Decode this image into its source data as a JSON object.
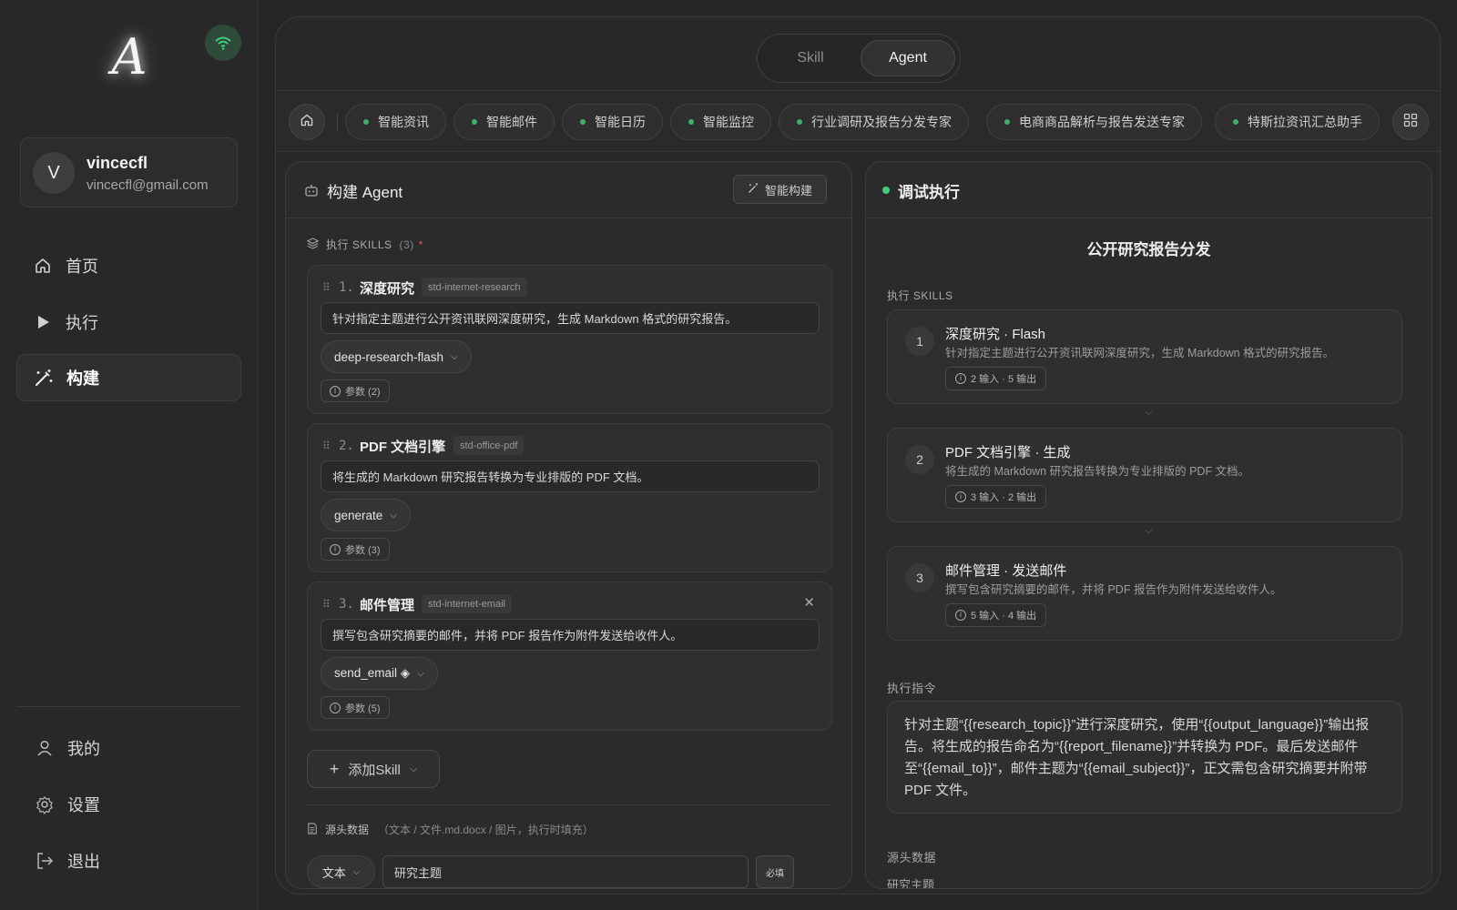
{
  "sidebar": {
    "logo": "A",
    "user": {
      "initial": "V",
      "name": "vincecfl",
      "email": "vincecfl@gmail.com"
    },
    "nav": [
      {
        "label": "首页",
        "icon": "home-icon"
      },
      {
        "label": "执行",
        "icon": "play-icon"
      },
      {
        "label": "构建",
        "icon": "magic-wand-icon",
        "active": true
      }
    ],
    "bottom_nav": [
      {
        "label": "我的",
        "icon": "user-icon"
      },
      {
        "label": "设置",
        "icon": "gear-icon"
      },
      {
        "label": "退出",
        "icon": "logout-icon"
      }
    ]
  },
  "mode_switch": {
    "options": [
      "Skill",
      "Agent"
    ],
    "selected": "Agent"
  },
  "agent_tabs": [
    "智能资讯",
    "智能邮件",
    "智能日历",
    "智能监控",
    "行业调研及报告分发专家",
    "电商商品解析与报告发送专家",
    "特斯拉资讯汇总助手"
  ],
  "builder": {
    "title": "构建 Agent",
    "smart_build_label": "智能构建",
    "skills_label": "执行 SKILLS",
    "skills_count": "(3)",
    "skills": [
      {
        "num": "1.",
        "name": "深度研究",
        "code": "std-internet-research",
        "desc": "针对指定主题进行公开资讯联网深度研究，生成 Markdown 格式的研究报告。",
        "method": "deep-research-flash",
        "params": "参数 (2)"
      },
      {
        "num": "2.",
        "name": "PDF 文档引擎",
        "code": "std-office-pdf",
        "desc": "将生成的 Markdown 研究报告转换为专业排版的 PDF 文档。",
        "method": "generate",
        "params": "参数 (3)"
      },
      {
        "num": "3.",
        "name": "邮件管理",
        "code": "std-internet-email",
        "desc": "撰写包含研究摘要的邮件，并将 PDF 报告作为附件发送给收件人。",
        "method": "send_email ◈",
        "params": "参数 (5)"
      }
    ],
    "add_skill_label": "添加Skill",
    "source_label": "源头数据",
    "source_hint": "（文本 / 文件.md.docx / 图片，执行时填充）",
    "source_type": "文本",
    "source_value": "研究主题",
    "required_label": "必填"
  },
  "debug": {
    "title": "调试执行",
    "status_color": "#3fae6a",
    "run_title": "公开研究报告分发",
    "skills_label": "执行 SKILLS",
    "skills": [
      {
        "num": "1",
        "name": "深度研究 · Flash",
        "desc": "针对指定主题进行公开资讯联网深度研究，生成 Markdown 格式的研究报告。",
        "io": "2 输入 · 5 输出"
      },
      {
        "num": "2",
        "name": "PDF 文档引擎 · 生成",
        "desc": "将生成的 Markdown 研究报告转换为专业排版的 PDF 文档。",
        "io": "3 输入 · 2 输出"
      },
      {
        "num": "3",
        "name": "邮件管理 · 发送邮件",
        "desc": "撰写包含研究摘要的邮件，并将 PDF 报告作为附件发送给收件人。",
        "io": "5 输入 · 4 输出"
      }
    ],
    "instruction_label": "执行指令",
    "instruction": "针对主题“{{research_topic}}”进行深度研究，使用“{{output_language}}”输出报告。将生成的报告命名为“{{report_filename}}”并转换为 PDF。最后发送邮件至“{{email_to}}”，邮件主题为“{{email_subject}}”，正文需包含研究摘要并附带 PDF 文件。",
    "source_label": "源头数据",
    "source_field": "研究主题"
  }
}
